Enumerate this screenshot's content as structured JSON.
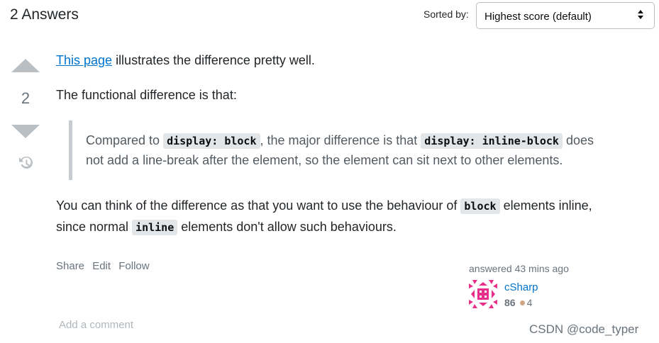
{
  "header": {
    "title": "2 Answers",
    "sort_label": "Sorted by:",
    "sort_value": "Highest score (default)"
  },
  "vote": {
    "count": "2"
  },
  "post": {
    "p1_link": "This page",
    "p1_rest": " illustrates the difference pretty well.",
    "p2": "The functional difference is that:",
    "quote": {
      "t1": "Compared to ",
      "code1": "display: block",
      "t2": ", the major difference is that ",
      "code2": "display: inline-block",
      "t3": " does",
      "t4": "not add a line-break after the element, so the element can sit next to other elements."
    },
    "p3": {
      "t1": "You can think of the difference as that you want to use the behaviour of ",
      "code1": "block",
      "t2": " elements inline,",
      "t3": "since normal ",
      "code2": "inline",
      "t4": " elements don't allow such behaviours."
    }
  },
  "actions": {
    "share": "Share",
    "edit": "Edit",
    "follow": "Follow"
  },
  "user_card": {
    "action_time": "answered 43 mins ago",
    "name": "cSharp",
    "reputation": "86",
    "bronze_badges": "4"
  },
  "comments": {
    "add_label": "Add a comment"
  },
  "watermark": "CSDN @code_typer",
  "colors": {
    "link": "#0074cc",
    "vote_arrow": "#babfc4",
    "avatar": "#e72e8b",
    "bronze": "#d1a684"
  },
  "icons": {
    "history": "history-icon",
    "sort": "sort-arrows-icon"
  }
}
